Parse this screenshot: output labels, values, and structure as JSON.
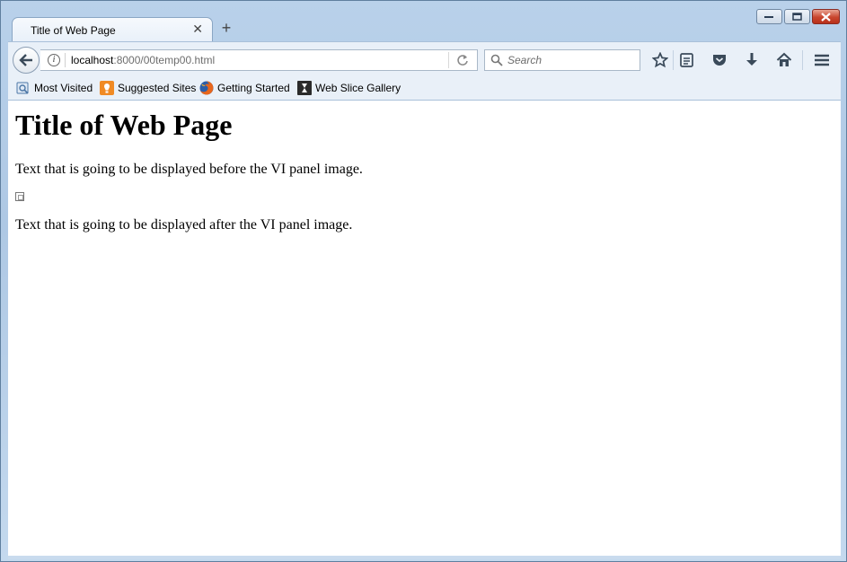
{
  "window": {
    "caption_buttons": [
      "minimize",
      "restore",
      "close"
    ]
  },
  "tabs": [
    {
      "title": "Title of Web Page",
      "close_glyph": "✕"
    }
  ],
  "new_tab_glyph": "+",
  "toolbar": {
    "url_host": "localhost",
    "url_rest": ":8000/00temp00.html",
    "search_placeholder": "Search",
    "icons": [
      "back-arrow-icon",
      "info-icon",
      "reload-icon",
      "search-icon",
      "bookmark-star-icon",
      "reading-list-icon",
      "pocket-icon",
      "download-icon",
      "home-icon",
      "menu-icon"
    ]
  },
  "bookmarks": [
    {
      "label": "Most Visited",
      "icon": "most-visited-icon"
    },
    {
      "label": "Suggested Sites",
      "icon": "suggested-sites-icon"
    },
    {
      "label": "Getting Started",
      "icon": "firefox-icon"
    },
    {
      "label": "Web Slice Gallery",
      "icon": "web-slice-icon"
    }
  ],
  "page": {
    "heading": "Title of Web Page",
    "text_before": "Text that is going to be displayed before the VI panel image.",
    "text_after": "Text that is going to be displayed after the VI panel image."
  },
  "colors": {
    "frame": "#b9d1ea",
    "toolbar": "#e9f0f8",
    "close_button": "#c9462e"
  }
}
